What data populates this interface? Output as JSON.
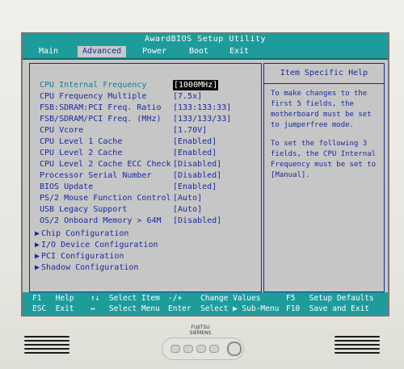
{
  "bios": {
    "title": "AwardBIOS Setup Utility",
    "menu": [
      "Main",
      "Advanced",
      "Power",
      "Boot",
      "Exit"
    ],
    "active_menu": "Advanced",
    "settings": [
      {
        "label": "CPU Internal Frequency",
        "value": "[1000MHz]"
      },
      {
        "label": "CPU Frequency Multiple",
        "value": "[7.5x]"
      },
      {
        "label": "FSB:SDRAM:PCI Freq. Ratio",
        "value": "[133:133:33]"
      },
      {
        "label": "FSB/SDRAM/PCI Freq. (MHz)",
        "value": "[133/133/33]"
      },
      {
        "label": "CPU Vcore",
        "value": "[1.70V]"
      },
      {
        "label": "CPU Level 1 Cache",
        "value": "[Enabled]"
      },
      {
        "label": "CPU Level 2 Cache",
        "value": "[Enabled]"
      },
      {
        "label": "CPU Level 2 Cache ECC Check",
        "value": "[Disabled]"
      },
      {
        "label": "Processor Serial Number",
        "value": "[Disabled]"
      },
      {
        "label": "BIOS Update",
        "value": "[Enabled]"
      },
      {
        "label": "PS/2 Mouse Function Control",
        "value": "[Auto]"
      },
      {
        "label": "USB Legacy Support",
        "value": "[Auto]"
      },
      {
        "label": "OS/2 Onboard Memory > 64M",
        "value": "[Disabled]"
      }
    ],
    "submenus": [
      "Chip Configuration",
      "I/O Device Configuration",
      "PCI Configuration",
      "Shadow Configuration"
    ],
    "help_title": "Item Specific Help",
    "help_p1": "To make changes to the first 5 fields, the motherboard must be set to jumperfree mode.",
    "help_p2": "To set the following 3 fields, the CPU Internal Frequency must be set to [Manual].",
    "footer": [
      {
        "key": "F1",
        "desc": "Help"
      },
      {
        "key": "↑↓",
        "desc": "Select Item"
      },
      {
        "key": "-/+",
        "desc": "Change Values"
      },
      {
        "key": "F5",
        "desc": "Setup Defaults"
      },
      {
        "key": "ESC",
        "desc": "Exit"
      },
      {
        "key": "↔",
        "desc": "Select Menu"
      },
      {
        "key": "Enter",
        "desc": "Select ▶ Sub-Menu"
      },
      {
        "key": "F10",
        "desc": "Save and Exit"
      }
    ]
  },
  "monitor": {
    "brand_line1": "FUJITSU",
    "brand_line2": "SIEMENS"
  },
  "colors": {
    "bios_bg": "#c6c6c6",
    "bios_text": "#1a2a9c",
    "title_bar": "#1e9c9c"
  },
  "icons": {
    "submenu_marker": "submenu-triangle-icon",
    "power_button": "power-icon"
  }
}
